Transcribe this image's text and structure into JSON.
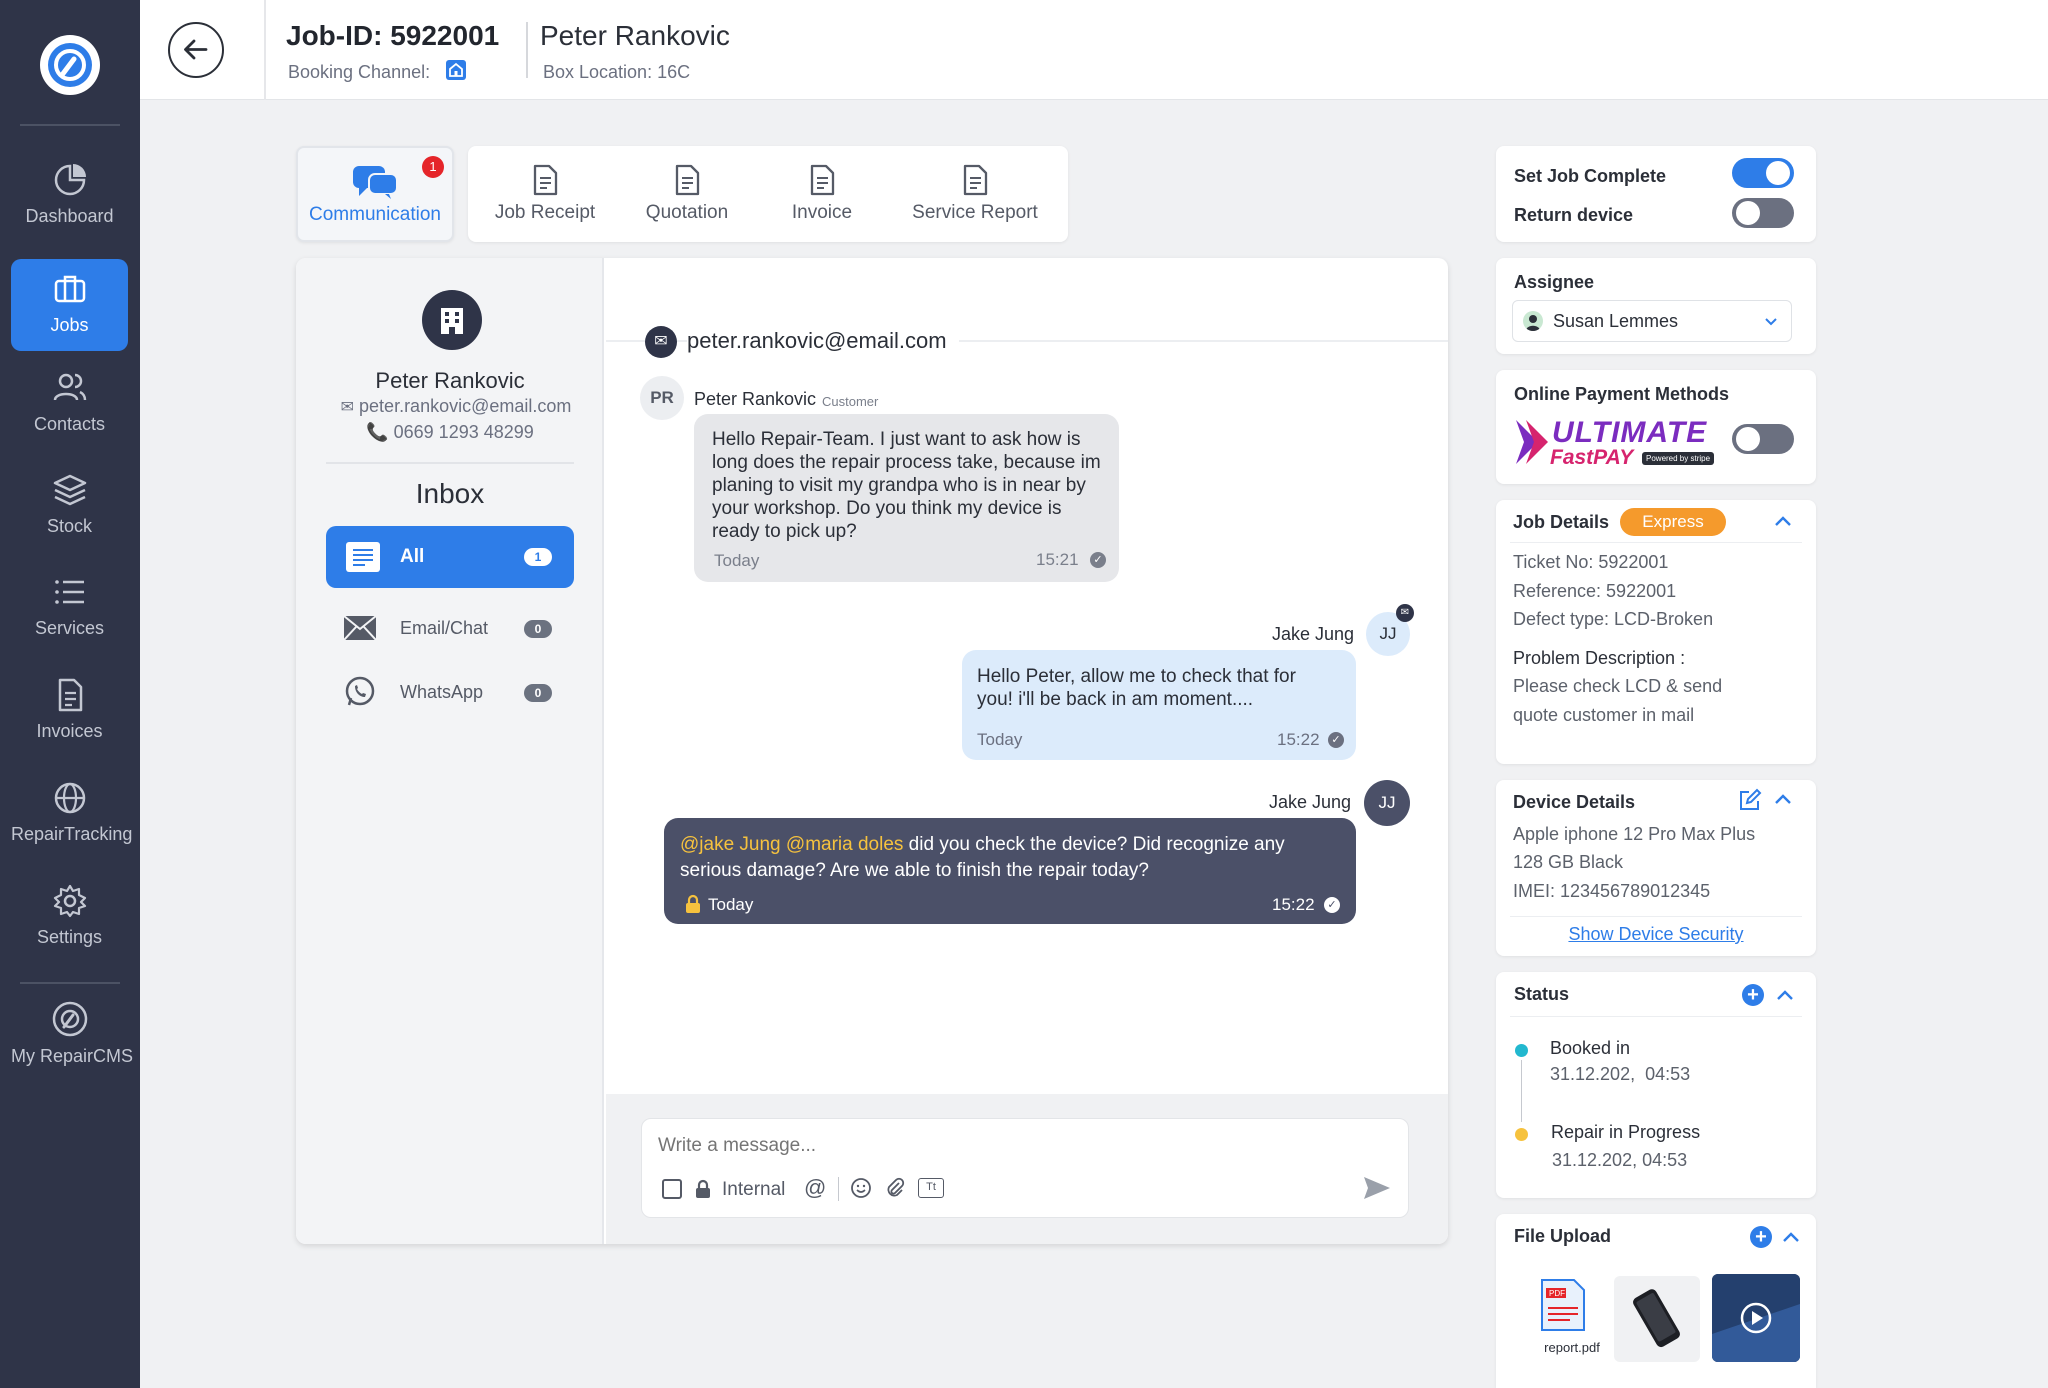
{
  "sidebar": {
    "items": [
      {
        "label": "Dashboard"
      },
      {
        "label": "Jobs"
      },
      {
        "label": "Contacts"
      },
      {
        "label": "Stock"
      },
      {
        "label": "Services"
      },
      {
        "label": "Invoices"
      },
      {
        "label": "RepairTracking"
      },
      {
        "label": "Settings"
      },
      {
        "label": "My RepairCMS"
      }
    ]
  },
  "header": {
    "job_id": "Job-ID: 5922001",
    "booking_channel": "Booking Channel:",
    "customer_name": "Peter Rankovic",
    "box_location": "Box Location: 16C"
  },
  "tabs": [
    {
      "label": "Communication",
      "badge": "1"
    },
    {
      "label": "Job Receipt"
    },
    {
      "label": "Quotation"
    },
    {
      "label": "Invoice"
    },
    {
      "label": "Service Report"
    }
  ],
  "contact": {
    "name": "Peter Rankovic",
    "email": "peter.rankovic@email.com",
    "phone": "0669 1293 48299"
  },
  "inbox": {
    "title": "Inbox",
    "items": [
      {
        "label": "All",
        "count": "1"
      },
      {
        "label": "Email/Chat",
        "count": "0"
      },
      {
        "label": "WhatsApp",
        "count": "0"
      }
    ]
  },
  "chat": {
    "header_email": "peter.rankovic@email.com",
    "messages": [
      {
        "initials": "PR",
        "sender": "Peter Rankovic",
        "role": "Customer",
        "text": "Hello Repair-Team. I just want to ask how is long does the repair process take, because im planing to visit my grandpa who is in near by your workshop. Do you think my device is ready to pick up?",
        "day": "Today",
        "time": "15:21"
      },
      {
        "initials": "JJ",
        "sender": "Jake Jung",
        "text": "Hello Peter, allow me to check that for you!  i'll be back in am moment....",
        "day": "Today",
        "time": "15:22"
      },
      {
        "initials": "JJ",
        "sender": "Jake Jung",
        "mention": "@jake Jung @maria doles",
        "text": " did you check the device? Did recognize any serious damage? Are we able to finish the repair today?",
        "day": "Today",
        "time": "15:22"
      }
    ],
    "composer": {
      "placeholder": "Write a message...",
      "internal_label": "Internal"
    }
  },
  "right": {
    "set_job_complete": "Set Job Complete",
    "set_job_complete_on": true,
    "return_device": "Return device",
    "return_device_on": false,
    "assignee_title": "Assignee",
    "assignee_name": "Susan Lemmes",
    "payment_title": "Online Payment Methods",
    "payment_logo_top": "ULTIMATE",
    "payment_logo_bottom": "FastPAY",
    "payment_logo_powered": "Powered by stripe",
    "job_details": {
      "title": "Job Details",
      "badge": "Express",
      "ticket": "Ticket No: 5922001",
      "reference": "Reference: 5922001",
      "defect": "Defect type: LCD-Broken",
      "problem_title": "Problem Description :",
      "problem_text_1": "Please check LCD & send",
      "problem_text_2": "quote customer in mail"
    },
    "device_details": {
      "title": "Device Details",
      "model": "Apple iphone 12 Pro Max Plus",
      "variant": "128 GB Black",
      "imei": "IMEI: 123456789012345",
      "link": "Show Device Security"
    },
    "status": {
      "title": "Status",
      "items": [
        {
          "label": "Booked in",
          "date": "31.12.202,  04:53",
          "color": "#22b8cf"
        },
        {
          "label": "Repair in Progress",
          "date": "31.12.202, 04:53",
          "color": "#f6c23e"
        }
      ]
    },
    "file_upload": {
      "title": "File Upload",
      "file_name": "report.pdf"
    }
  },
  "colors": {
    "sidebar": "#2f3448",
    "accent": "#2e7de8",
    "express": "#f59a2c",
    "bubble_internal": "#4b5068",
    "bubble_outgoing": "#dcebfb"
  }
}
